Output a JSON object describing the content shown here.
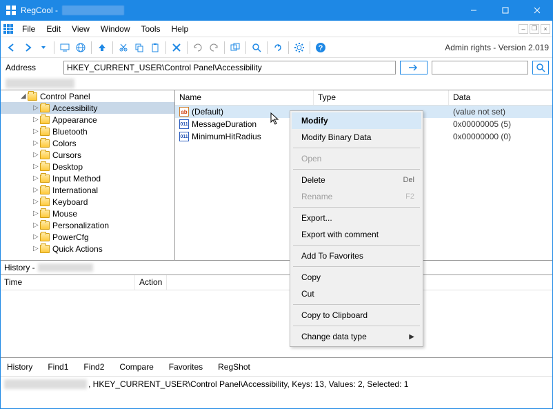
{
  "titlebar": {
    "app": "RegCool - "
  },
  "menu": {
    "items": [
      "File",
      "Edit",
      "View",
      "Window",
      "Tools",
      "Help"
    ]
  },
  "toolbar": {
    "rights": "Admin rights - Version 2.019"
  },
  "address": {
    "label": "Address",
    "value": "HKEY_CURRENT_USER\\Control Panel\\Accessibility",
    "search": ""
  },
  "tree": {
    "root": "Control Panel",
    "items": [
      "Accessibility",
      "Appearance",
      "Bluetooth",
      "Colors",
      "Cursors",
      "Desktop",
      "Input Method",
      "International",
      "Keyboard",
      "Mouse",
      "Personalization",
      "PowerCfg",
      "Quick Actions"
    ],
    "selected": "Accessibility"
  },
  "list": {
    "headers": {
      "name": "Name",
      "type": "Type",
      "data": "Data"
    },
    "rows": [
      {
        "icon": "sz",
        "name": "(Default)",
        "type": "",
        "data": "(value not set)",
        "selected": true
      },
      {
        "icon": "dw",
        "name": "MessageDuration",
        "type": "",
        "data": "0x00000005 (5)"
      },
      {
        "icon": "dw",
        "name": "MinimumHitRadius",
        "type": "",
        "data": "0x00000000 (0)"
      }
    ]
  },
  "context_menu": {
    "items": [
      {
        "label": "Modify",
        "highlighted": true
      },
      {
        "label": "Modify Binary Data"
      },
      {
        "sep": true
      },
      {
        "label": "Open",
        "disabled": true
      },
      {
        "sep": true
      },
      {
        "label": "Delete",
        "shortcut": "Del"
      },
      {
        "label": "Rename",
        "shortcut": "F2",
        "disabled": true
      },
      {
        "sep": true
      },
      {
        "label": "Export..."
      },
      {
        "label": "Export with comment"
      },
      {
        "sep": true
      },
      {
        "label": "Add To Favorites"
      },
      {
        "sep": true
      },
      {
        "label": "Copy"
      },
      {
        "label": "Cut"
      },
      {
        "sep": true
      },
      {
        "label": "Copy to Clipboard"
      },
      {
        "sep": true
      },
      {
        "label": "Change data type",
        "submenu": true
      }
    ]
  },
  "history": {
    "header": "History - ",
    "time": "Time",
    "action": "Action"
  },
  "tabs": [
    "History",
    "Find1",
    "Find2",
    "Compare",
    "Favorites",
    "RegShot"
  ],
  "status": ", HKEY_CURRENT_USER\\Control Panel\\Accessibility, Keys: 13, Values: 2, Selected: 1"
}
